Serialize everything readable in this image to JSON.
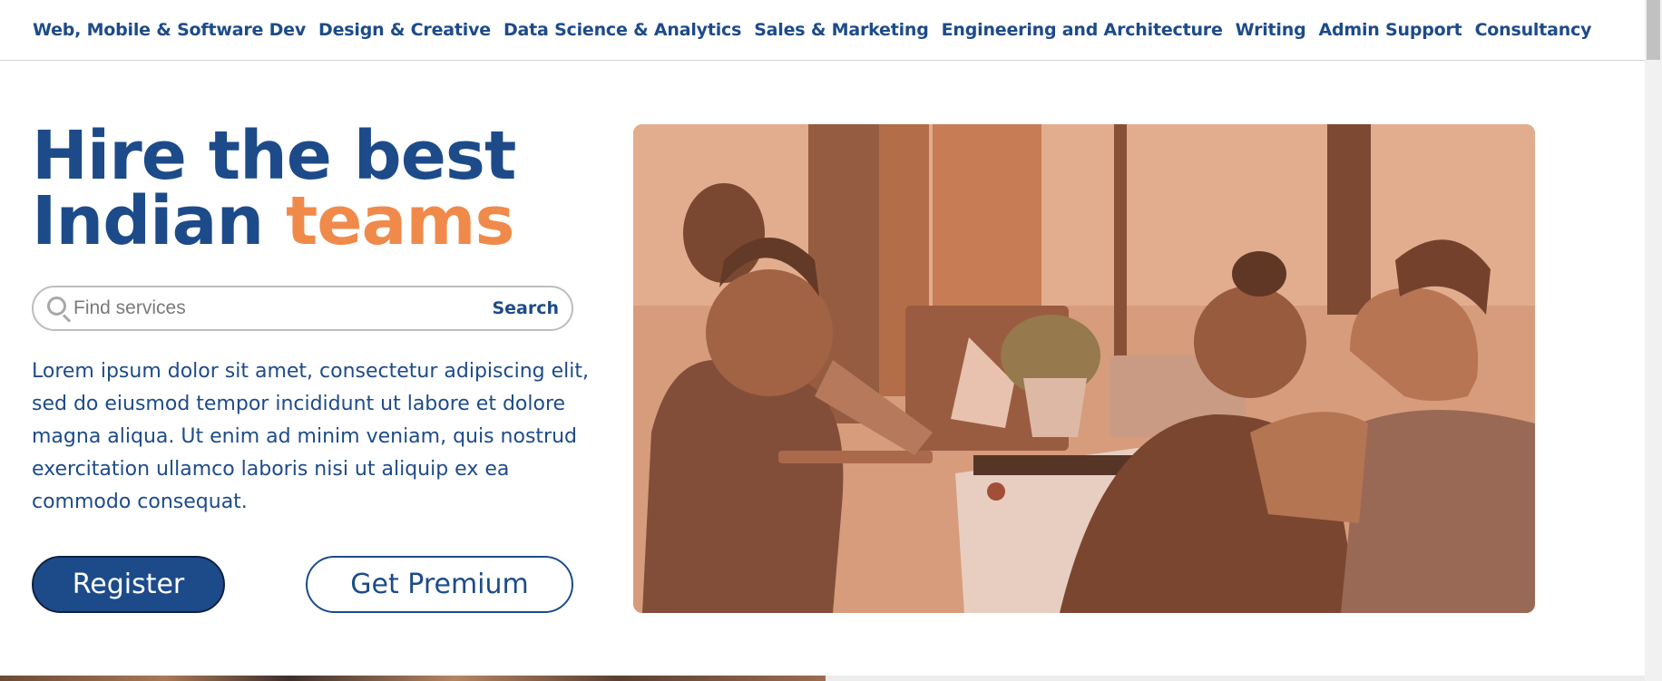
{
  "nav": {
    "items": [
      "Web, Mobile & Software Dev",
      "Design & Creative",
      "Data Science & Analytics",
      "Sales & Marketing",
      "Engineering and Architecture",
      "Writing",
      "Admin Support",
      "Consultancy"
    ]
  },
  "hero": {
    "title_line1": "Hire the best",
    "title_line2": "Indian ",
    "title_accent": "teams",
    "description": "Lorem ipsum dolor sit amet, consectetur adipiscing elit, sed do eiusmod tempor incididunt ut labore et dolore magna aliqua. Ut enim ad minim veniam, quis nostrud exercitation ullamco laboris nisi ut aliquip ex ea commodo consequat.",
    "register_label": "Register",
    "premium_label": "Get Premium"
  },
  "search": {
    "placeholder": "Find services",
    "button_label": "Search",
    "icon": "search-icon"
  },
  "colors": {
    "primary": "#1d4b8a",
    "accent": "#f08a4b",
    "image_tint": "#c78d6c"
  }
}
